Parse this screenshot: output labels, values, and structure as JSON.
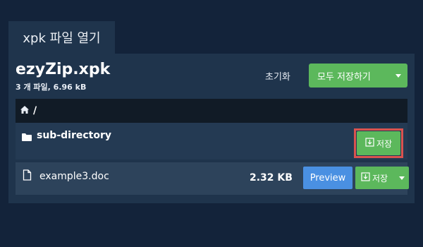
{
  "tab": {
    "label": "xpk 파일 열기"
  },
  "archive": {
    "name": "ezyZip.xpk",
    "summary": "3 개 파일, 6.96 kB"
  },
  "toolbar": {
    "reset_label": "초기화",
    "save_all_label": "모두 저장하기"
  },
  "breadcrumb": {
    "path": "/"
  },
  "directories": [
    {
      "name": "sub-directory",
      "save_label": "저장"
    }
  ],
  "files": [
    {
      "name": "example3.doc",
      "size": "2.32 KB",
      "preview_label": "Preview",
      "save_label": "저장"
    }
  ],
  "colors": {
    "background": "#13233a",
    "panel": "#1f344c",
    "green": "#5cb85c",
    "blue": "#4a90e2",
    "highlight": "#d9534f"
  },
  "icons": [
    "home-icon",
    "folder-icon",
    "file-icon",
    "download-icon",
    "chevron-down-icon"
  ]
}
